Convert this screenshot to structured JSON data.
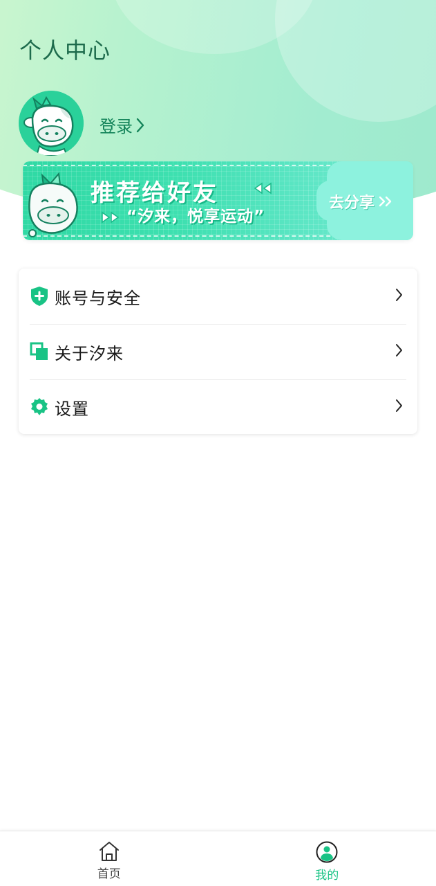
{
  "header": {
    "title": "个人中心"
  },
  "profile": {
    "login_label": "登录"
  },
  "share_banner": {
    "title": "推荐给好友",
    "subtitle": "“汐来，悦享运动”",
    "action_label": "去分享"
  },
  "menu": {
    "items": [
      {
        "label": "账号与安全",
        "icon": "shield-plus-icon"
      },
      {
        "label": "关于汐来",
        "icon": "overlap-squares-icon"
      },
      {
        "label": "设置",
        "icon": "gear-icon"
      }
    ]
  },
  "tabbar": {
    "tabs": [
      {
        "label": "首页",
        "icon": "home-icon",
        "active": false
      },
      {
        "label": "我的",
        "icon": "user-icon",
        "active": true
      }
    ]
  },
  "colors": {
    "accent": "#19c385",
    "title_green": "#1d6b4c",
    "login_green": "#138359",
    "banner_green": "#2fd9a4"
  }
}
